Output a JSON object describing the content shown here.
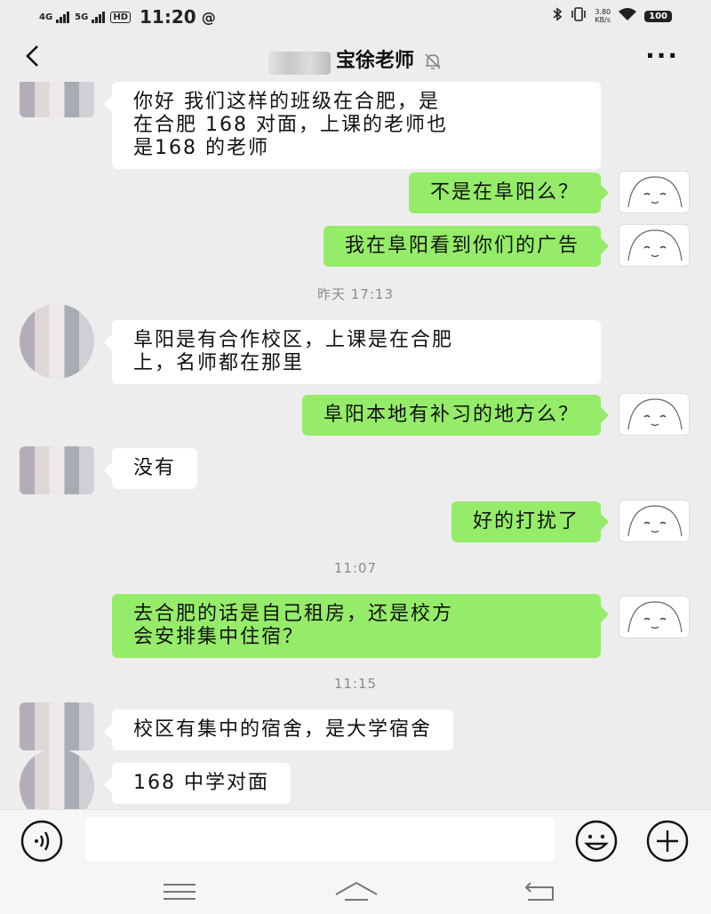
{
  "status_bar": {
    "net1": "4G",
    "net2": "5G",
    "hd": "HD",
    "time": "11:20",
    "speed_value": "3.80",
    "speed_unit": "KB/s",
    "battery": "100"
  },
  "header": {
    "title": "宝徐老师",
    "icons": [
      "back-icon",
      "mute-bell-icon",
      "more-icon"
    ]
  },
  "messages": [
    {
      "side": "in",
      "lines": [
        "你好  我们这样的班级在合肥，是",
        "在合肥 168 对面，上课的老师也",
        "是168 的老师"
      ]
    },
    {
      "side": "out",
      "lines": [
        "不是在阜阳么？"
      ]
    },
    {
      "side": "out",
      "lines": [
        "我在阜阳看到你们的广告"
      ]
    },
    {
      "timestamp": "昨天 17:13"
    },
    {
      "side": "in",
      "lines": [
        "阜阳是有合作校区，上课是在合肥",
        "上，名师都在那里"
      ]
    },
    {
      "side": "out",
      "lines": [
        "阜阳本地有补习的地方么？"
      ]
    },
    {
      "side": "in",
      "lines": [
        "没有"
      ]
    },
    {
      "side": "out",
      "lines": [
        "好的打扰了"
      ]
    },
    {
      "timestamp": "11:07"
    },
    {
      "side": "out",
      "lines": [
        "去合肥的话是自己租房，还是校方",
        "会安排集中住宿？"
      ]
    },
    {
      "timestamp": "11:15"
    },
    {
      "side": "in",
      "lines": [
        "校区有集中的宿舍，是大学宿舍"
      ]
    },
    {
      "side": "in",
      "lines": [
        "168 中学对面"
      ]
    }
  ],
  "input_bar": {
    "icons": [
      "voice-icon",
      "emoji-icon",
      "plus-icon"
    ],
    "value": ""
  },
  "system_nav": {
    "icons": [
      "menu-icon",
      "home-icon",
      "back-return-icon"
    ]
  },
  "colors": {
    "background": "#ededed",
    "outgoing_bubble": "#95ec69",
    "incoming_bubble": "#ffffff",
    "timestamp_text": "#8a8a8a"
  }
}
